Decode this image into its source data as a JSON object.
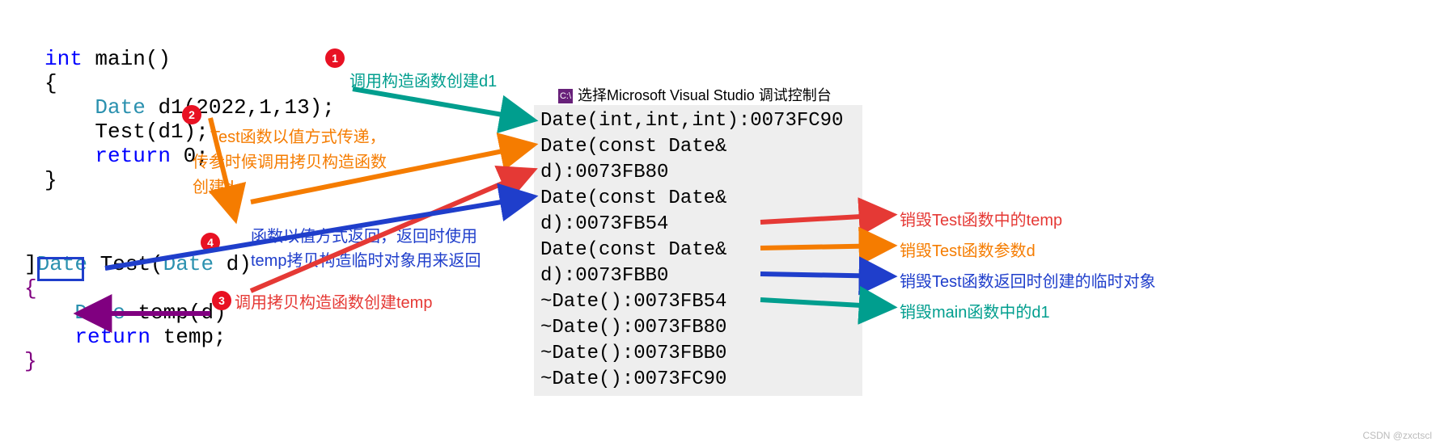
{
  "code": {
    "main": {
      "l1": "int main()",
      "l2": "{",
      "l3": "    Date d1(2022,1,13);",
      "l4": "    Test(d1);",
      "l5": "    return 0;",
      "l6": "}"
    },
    "test": {
      "l1": "]Date Test(Date d)",
      "l2": "{",
      "l3": "    Date temp(d)",
      "l4": "    return temp;",
      "l5": "}"
    }
  },
  "badges": {
    "b1": "1",
    "b2": "2",
    "b3": "3",
    "b4": "4"
  },
  "notes": {
    "n1": {
      "text": "调用构造函数创建d1",
      "color": "#009e8e"
    },
    "n2a": {
      "text": "Test函数以值方式传递，",
      "color": "#f57c00"
    },
    "n2b": {
      "text": "传参时候调用拷贝构造函数",
      "color": "#f57c00"
    },
    "n2c": {
      "text": "创建d",
      "color": "#f57c00"
    },
    "n3": {
      "text": "调用拷贝构造函数创建temp",
      "color": "#e53935"
    },
    "n4a": {
      "text": "函数以值方式返回，返回时使用",
      "color": "#1f3ecb"
    },
    "n4b": {
      "text": "temp拷贝构造临时对象用来返回",
      "color": "#1f3ecb"
    }
  },
  "console": {
    "title": "选择Microsoft Visual Studio 调试控制台",
    "lines": [
      "Date(int,int,int):0073FC90",
      "Date(const Date& d):0073FB80",
      "Date(const Date& d):0073FB54",
      "Date(const Date& d):0073FBB0",
      "~Date():0073FB54",
      "~Date():0073FB80",
      "~Date():0073FBB0",
      "~Date():0073FC90"
    ]
  },
  "rightNotes": {
    "r1": {
      "text": "销毁Test函数中的temp",
      "color": "#e53935"
    },
    "r2": {
      "text": "销毁Test函数参数d",
      "color": "#f57c00"
    },
    "r3": {
      "text": "销毁Test函数返回时创建的临时对象",
      "color": "#1f3ecb"
    },
    "r4": {
      "text": "销毁main函数中的d1",
      "color": "#009e8e"
    }
  },
  "watermark": "CSDN @zxctscl",
  "colors": {
    "teal": "#009e8e",
    "orange": "#f57c00",
    "red": "#e53935",
    "blue": "#1f3ecb",
    "purple": "#800080"
  }
}
